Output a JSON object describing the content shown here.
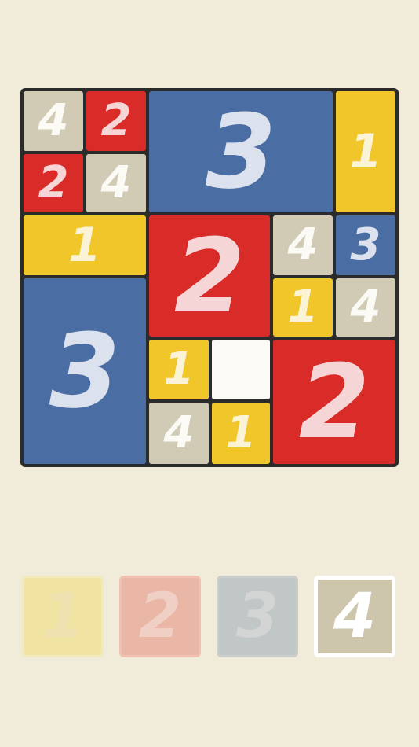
{
  "board": {
    "tiles": [
      {
        "name": "tile-r0c0",
        "label": "4",
        "color": "c4"
      },
      {
        "name": "tile-r0c1",
        "label": "2",
        "color": "c2"
      },
      {
        "name": "tile-r0c2",
        "label": "3",
        "color": "c3"
      },
      {
        "name": "tile-r0c5",
        "label": "1",
        "color": "c1"
      },
      {
        "name": "tile-r1c0",
        "label": "2",
        "color": "c2"
      },
      {
        "name": "tile-r1c1",
        "label": "4",
        "color": "c4"
      },
      {
        "name": "tile-r2c0",
        "label": "1",
        "color": "c1"
      },
      {
        "name": "tile-r2c2",
        "label": "2",
        "color": "c2"
      },
      {
        "name": "tile-r2c4",
        "label": "4",
        "color": "c4"
      },
      {
        "name": "tile-r2c5",
        "label": "3",
        "color": "c3"
      },
      {
        "name": "tile-r3c0",
        "label": "3",
        "color": "c3"
      },
      {
        "name": "tile-r3c4",
        "label": "1",
        "color": "c1"
      },
      {
        "name": "tile-r3c5",
        "label": "4",
        "color": "c4"
      },
      {
        "name": "tile-r4c2",
        "label": "1",
        "color": "c1"
      },
      {
        "name": "tile-r4c3-empty",
        "label": "",
        "color": "empty"
      },
      {
        "name": "tile-r4c4",
        "label": "2",
        "color": "c2"
      },
      {
        "name": "tile-r5c2",
        "label": "4",
        "color": "c4"
      },
      {
        "name": "tile-r5c3",
        "label": "1",
        "color": "c1"
      }
    ]
  },
  "picker": {
    "items": [
      {
        "name": "picker-1",
        "label": "1",
        "style": "p1"
      },
      {
        "name": "picker-2",
        "label": "2",
        "style": "p2"
      },
      {
        "name": "picker-3",
        "label": "3",
        "style": "p3"
      },
      {
        "name": "picker-4",
        "label": "4",
        "style": "p4",
        "selected": true
      }
    ]
  },
  "colors": {
    "background": "#f1ecda",
    "yellow": "#f0c62b",
    "red": "#d92b27",
    "blue": "#4a6ea3",
    "beige": "#d1cab5",
    "board_border": "#2b2b2b"
  }
}
